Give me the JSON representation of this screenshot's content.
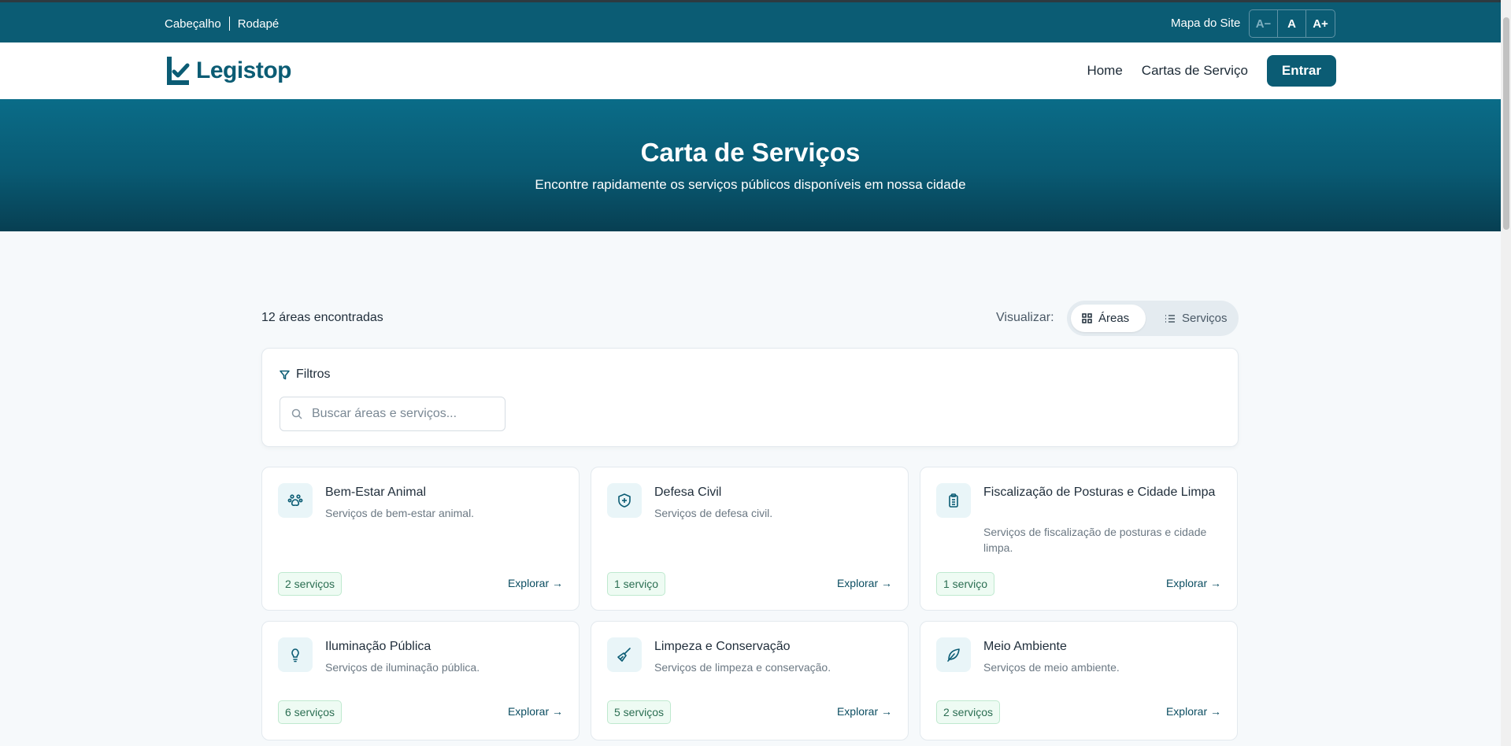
{
  "topbar": {
    "link_header": "Cabeçalho",
    "link_footer": "Rodapé",
    "sitemap": "Mapa do Site",
    "font_decrease": "A−",
    "font_reset": "A",
    "font_increase": "A+"
  },
  "navbar": {
    "brand": "Legistop",
    "links": [
      "Home",
      "Cartas de Serviço"
    ],
    "login": "Entrar"
  },
  "hero": {
    "title": "Carta de Serviços",
    "subtitle": "Encontre rapidamente os serviços públicos disponíveis em nossa cidade"
  },
  "results": {
    "count_text": "12 áreas encontradas",
    "view_label": "Visualizar:",
    "view_options": [
      "Áreas",
      "Serviços"
    ],
    "active_view": "Áreas"
  },
  "filters": {
    "title": "Filtros",
    "search_placeholder": "Buscar áreas e serviços..."
  },
  "cards": [
    {
      "icon": "paw-icon",
      "title": "Bem-Estar Animal",
      "desc": "Serviços de bem-estar animal.",
      "badge": "2 serviços",
      "explore": "Explorar →"
    },
    {
      "icon": "shield-plus-icon",
      "title": "Defesa Civil",
      "desc": "Serviços de defesa civil.",
      "badge": "1 serviço",
      "explore": "Explorar →"
    },
    {
      "icon": "clipboard-icon",
      "title": "Fiscalização de Posturas e Cidade Limpa",
      "desc": "Serviços de fiscalização de posturas e cidade limpa.",
      "badge": "1 serviço",
      "explore": "Explorar →"
    },
    {
      "icon": "lightbulb-icon",
      "title": "Iluminação Pública",
      "desc": "Serviços de iluminação pública.",
      "badge": "6 serviços",
      "explore": "Explorar →"
    },
    {
      "icon": "broom-icon",
      "title": "Limpeza e Conservação",
      "desc": "Serviços de limpeza e conservação.",
      "badge": "5 serviços",
      "explore": "Explorar →"
    },
    {
      "icon": "leaf-icon",
      "title": "Meio Ambiente",
      "desc": "Serviços de meio ambiente.",
      "badge": "2 serviços",
      "explore": "Explorar →"
    }
  ],
  "colors": {
    "primary": "#0b5c74",
    "badge_bg": "#eefbf3",
    "badge_text": "#2b6e52"
  }
}
